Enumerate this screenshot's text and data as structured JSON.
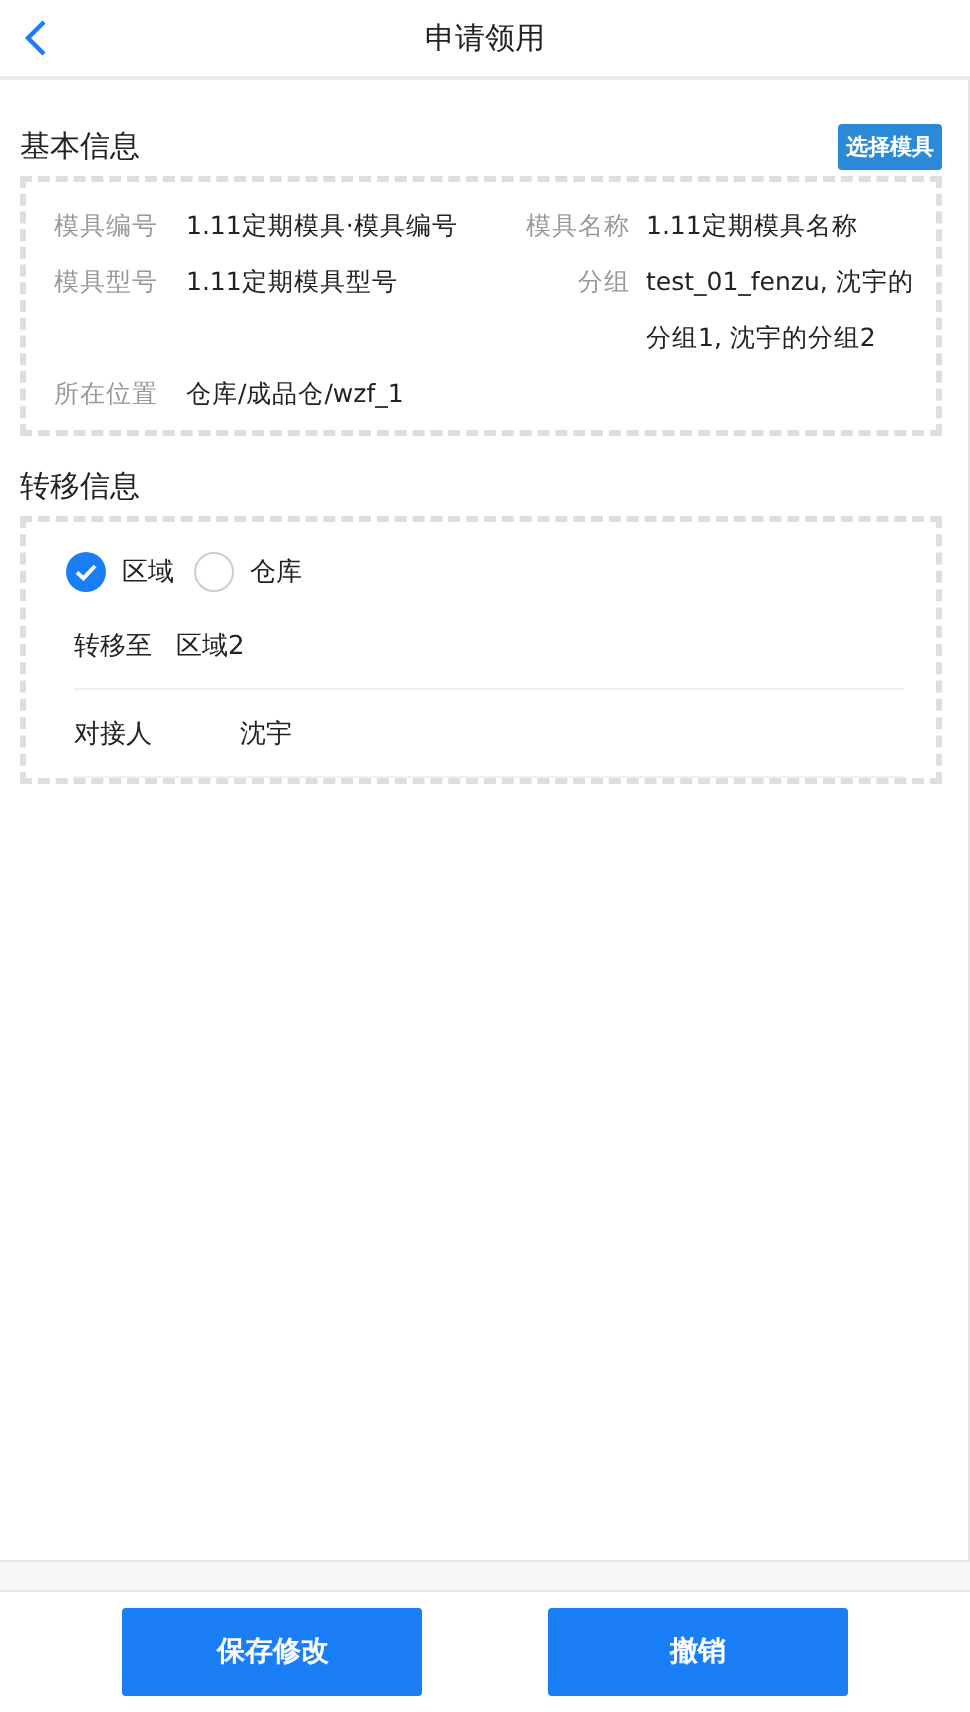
{
  "header": {
    "title": "申请领用"
  },
  "basic_info": {
    "title": "基本信息",
    "action": "选择模具",
    "fields": [
      {
        "label": "模具编号",
        "value": "1.11定期模具·模具编号"
      },
      {
        "label": "模具名称",
        "value": "1.11定期模具名称"
      },
      {
        "label": "模具型号",
        "value": "1.11定期模具型号"
      },
      {
        "label": "分组",
        "value": "test_01_fenzu, 沈宇的分组1, 沈宇的分组2"
      },
      {
        "label": "所在位置",
        "value": "仓库/成品仓/wzf_1"
      }
    ]
  },
  "transfer_info": {
    "title": "转移信息",
    "options": [
      {
        "label": "区域",
        "selected": true
      },
      {
        "label": "仓库",
        "selected": false
      }
    ],
    "fields": [
      {
        "kind": "select",
        "label": "转移至",
        "value": "区域2"
      },
      {
        "kind": "input",
        "label": "对接人",
        "value": "沈宇"
      }
    ]
  },
  "buttons": [
    "保存修改",
    "撤销"
  ]
}
